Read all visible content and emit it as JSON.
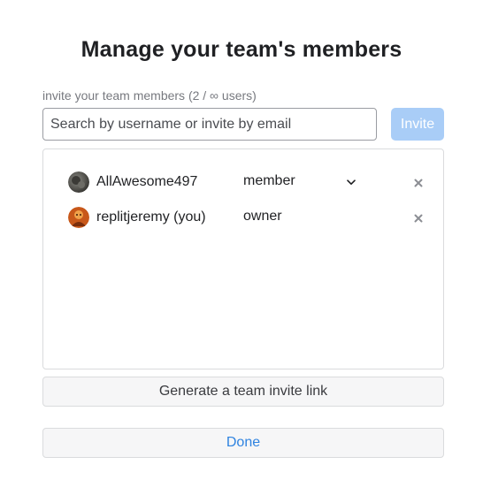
{
  "dialog": {
    "title": "Manage your team's members"
  },
  "invite": {
    "label": "invite your team members (2 / ∞ users)",
    "search_placeholder": "Search by username or invite by email",
    "search_value": "",
    "button_label": "Invite",
    "button_color": "#a9cdf7"
  },
  "members": [
    {
      "name": "AllAwesome497",
      "role": "member",
      "role_editable": true,
      "avatar_icon": "user-avatar-gray",
      "remove_icon": "close-icon"
    },
    {
      "name": "replitjeremy (you)",
      "role": "owner",
      "role_editable": false,
      "avatar_icon": "user-avatar-orange",
      "remove_icon": "close-icon"
    }
  ],
  "actions": {
    "generate_link_label": "Generate a team invite link",
    "done_label": "Done"
  },
  "colors": {
    "accent": "#2f83e0",
    "invite_disabled": "#a9cdf7",
    "border": "#dadbdd"
  }
}
